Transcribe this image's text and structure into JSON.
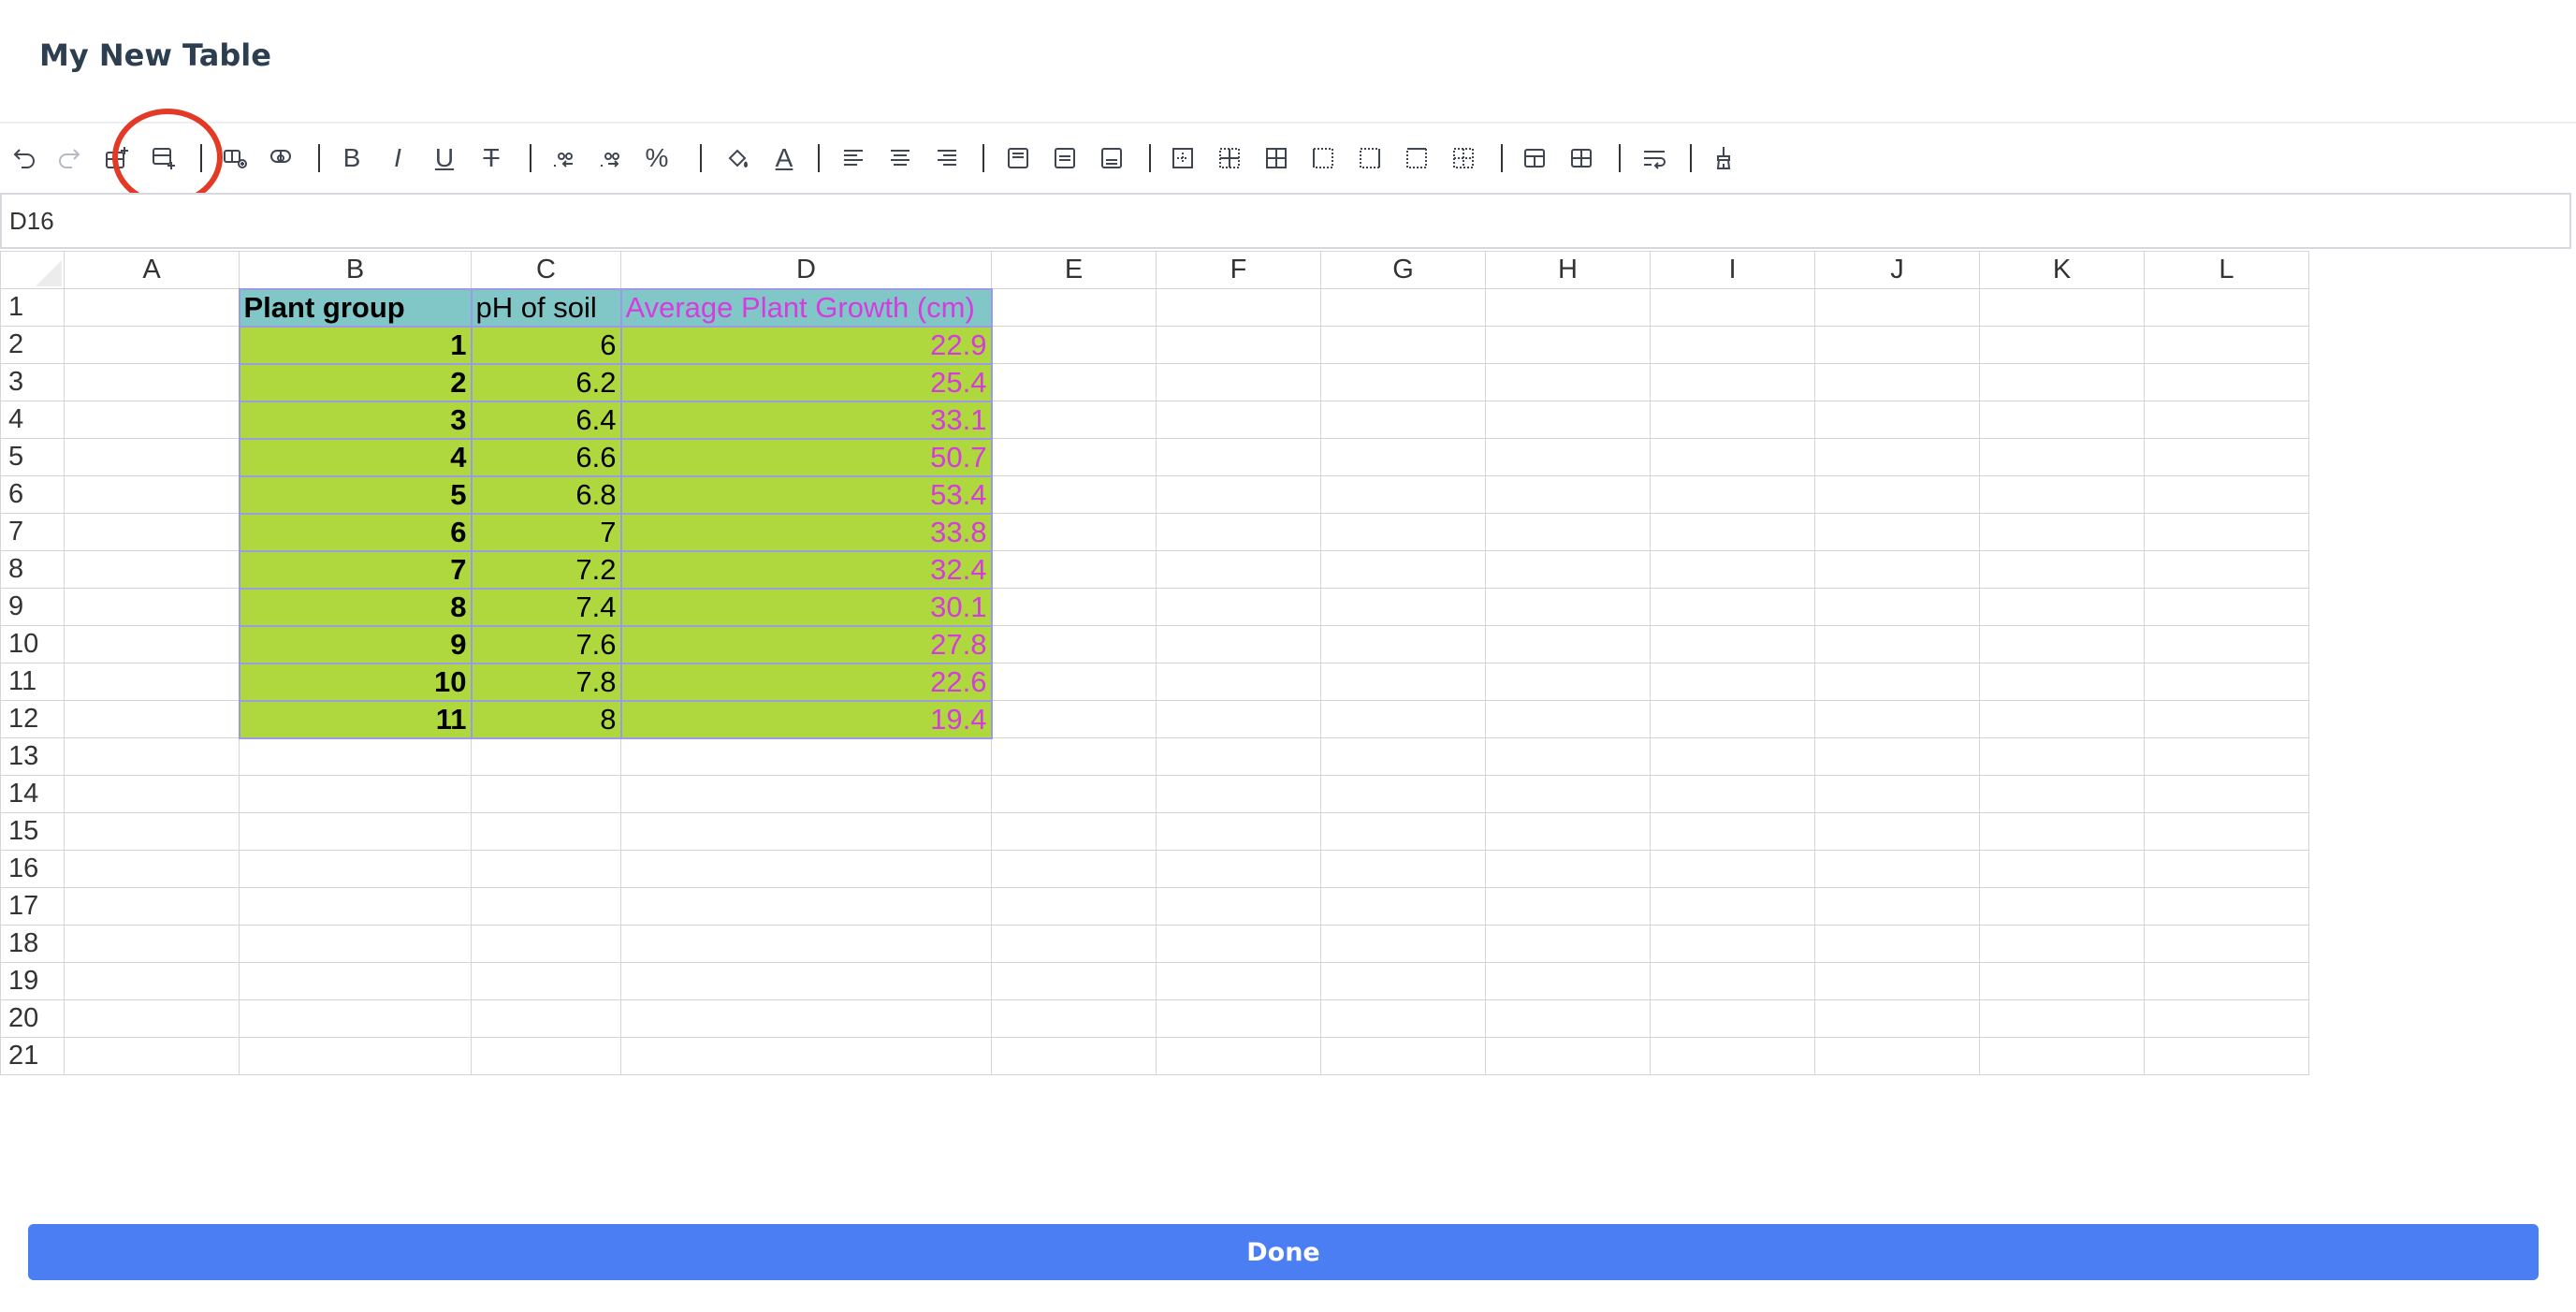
{
  "title": "My New Table",
  "formula_bar": {
    "cell_ref": "D16"
  },
  "toolbar": {
    "buttons": [
      {
        "name": "undo-icon"
      },
      {
        "name": "redo-icon"
      },
      {
        "name": "insert-row-above-icon"
      },
      {
        "name": "insert-row-below-icon"
      },
      {
        "name": "insert-column-left-icon"
      },
      {
        "name": "insert-column-right-icon"
      },
      {
        "name": "bold-icon",
        "glyph": "B"
      },
      {
        "name": "italic-icon",
        "glyph": "I"
      },
      {
        "name": "underline-icon",
        "glyph": "U"
      },
      {
        "name": "strikethrough-icon",
        "glyph": "T"
      },
      {
        "name": "decrease-decimal-icon"
      },
      {
        "name": "increase-decimal-icon"
      },
      {
        "name": "percent-icon",
        "glyph": "%"
      },
      {
        "name": "fill-color-icon"
      },
      {
        "name": "text-color-icon",
        "glyph": "A"
      },
      {
        "name": "align-left-icon"
      },
      {
        "name": "align-center-icon"
      },
      {
        "name": "align-right-icon"
      },
      {
        "name": "valign-top-icon"
      },
      {
        "name": "valign-middle-icon"
      },
      {
        "name": "valign-bottom-icon"
      },
      {
        "name": "border-outer-icon"
      },
      {
        "name": "border-inner-icon"
      },
      {
        "name": "border-all-icon"
      },
      {
        "name": "border-left-icon"
      },
      {
        "name": "border-right-icon"
      },
      {
        "name": "border-top-icon"
      },
      {
        "name": "border-none-icon"
      },
      {
        "name": "merge-cells-icon"
      },
      {
        "name": "unmerge-cells-icon"
      },
      {
        "name": "wrap-text-icon"
      },
      {
        "name": "clear-format-icon"
      }
    ],
    "highlighted": "insert-row-below-icon",
    "highlight_color": "#e23a26"
  },
  "sheet": {
    "columns": [
      "A",
      "B",
      "C",
      "D",
      "E",
      "F",
      "G",
      "H",
      "I",
      "J",
      "K",
      "L"
    ],
    "rows": [
      "1",
      "2",
      "3",
      "4",
      "5",
      "6",
      "7",
      "8",
      "9",
      "10",
      "11",
      "12",
      "13",
      "14",
      "15",
      "16",
      "17",
      "18",
      "19",
      "20",
      "21"
    ],
    "header": {
      "b": "Plant group",
      "c": "pH of soil",
      "d": "Average Plant Growth (cm)"
    },
    "data": [
      {
        "b": "1",
        "c": "6",
        "d": "22.9"
      },
      {
        "b": "2",
        "c": "6.2",
        "d": "25.4"
      },
      {
        "b": "3",
        "c": "6.4",
        "d": "33.1"
      },
      {
        "b": "4",
        "c": "6.6",
        "d": "50.7"
      },
      {
        "b": "5",
        "c": "6.8",
        "d": "53.4"
      },
      {
        "b": "6",
        "c": "7",
        "d": "33.8"
      },
      {
        "b": "7",
        "c": "7.2",
        "d": "32.4"
      },
      {
        "b": "8",
        "c": "7.4",
        "d": "30.1"
      },
      {
        "b": "9",
        "c": "7.6",
        "d": "27.8"
      },
      {
        "b": "10",
        "c": "7.8",
        "d": "22.6"
      },
      {
        "b": "11",
        "c": "8",
        "d": "19.4"
      }
    ],
    "colors": {
      "header_fill": "#82c7c7",
      "data_fill": "#afd83e",
      "growth_text": "#d53cdc",
      "selection_border": "#9b9ae6"
    }
  },
  "done_button": {
    "label": "Done",
    "color": "#4a7ef2"
  }
}
